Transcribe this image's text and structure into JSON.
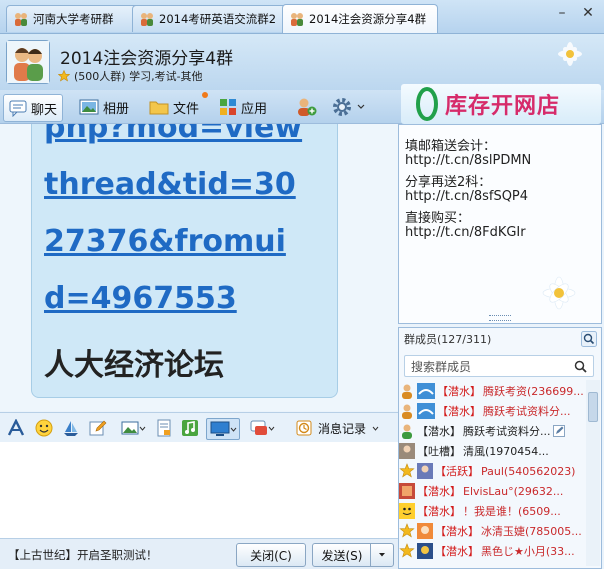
{
  "tabs": [
    {
      "label": "河南大学考研群",
      "active": false
    },
    {
      "label": "2014考研英语交流群2",
      "active": false
    },
    {
      "label": "2014注会资源分享4群",
      "active": true
    }
  ],
  "window": {
    "minimize": "–",
    "close": "✕"
  },
  "header": {
    "title": "2014注会资源分享4群",
    "subtitle": "(500人群) 学习,考试-其他"
  },
  "toolbar": {
    "chat": "聊天",
    "album": "相册",
    "files": "文件",
    "apps": "应用"
  },
  "ad": {
    "text": "库存开网店"
  },
  "chat": {
    "link_lines": [
      "php?mod=view",
      "thread&tid=30",
      "27376&fromui",
      "d=4967553"
    ],
    "forum_name": "人大经济论坛"
  },
  "notice": {
    "lines": [
      "填邮箱送会计：",
      "http://t.cn/8slPDMN",
      "分享再送2科：",
      "http://t.cn/8sfSQP4",
      "直接购买：",
      "http://t.cn/8FdKGIr"
    ]
  },
  "members": {
    "header": "群成员(127/311)",
    "search_placeholder": "搜索群成员",
    "list": [
      {
        "tag": "【潜水】",
        "name": "腾跃考资(236699..."
      },
      {
        "tag": "【潜水】",
        "name": "腾跃考试资料分..."
      },
      {
        "tag": "【潜水】",
        "name": "腾跃考试资料分..."
      },
      {
        "tag": "【吐槽】",
        "name": "清風(1970454..."
      },
      {
        "tag": "【活跃】",
        "name": "Paul(540562023)"
      },
      {
        "tag": "【潜水】",
        "name": "ElvisLau°(29632..."
      },
      {
        "tag": "【潜水】",
        "name": "！我是谁！(6509..."
      },
      {
        "tag": "【潜水】",
        "name": "冰清玉婕(785005..."
      },
      {
        "tag": "【潜水】",
        "name": "黑色じ★小月(33..."
      }
    ]
  },
  "format_toolbar": {
    "history": "消息记录"
  },
  "footer": {
    "status": "【上古世纪】开启圣职测试！",
    "close": "关闭(C)",
    "send": "发送(S)"
  }
}
